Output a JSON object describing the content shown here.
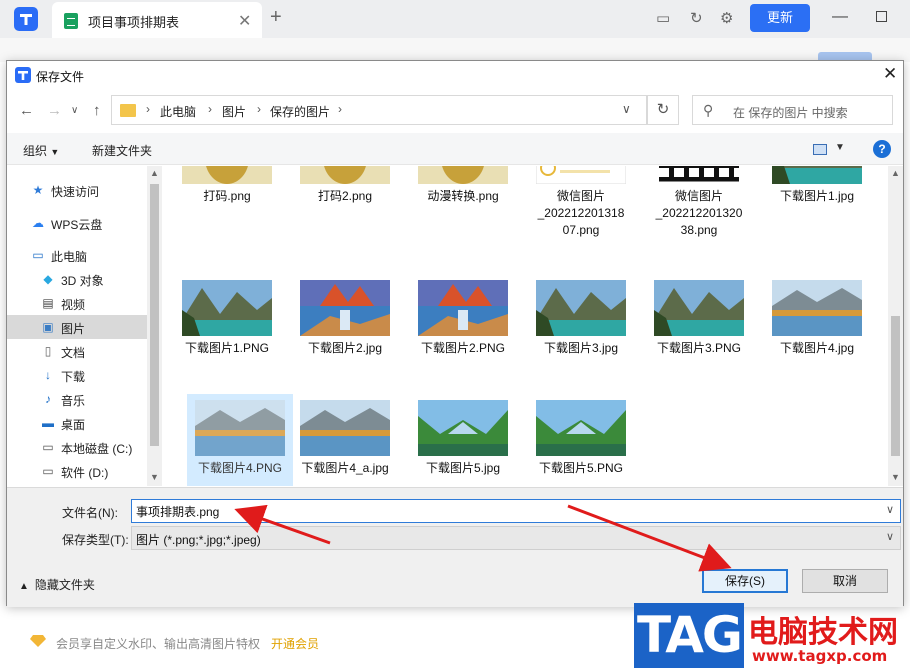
{
  "app": {
    "tab_title": "项目事项排期表",
    "update_label": "更新"
  },
  "dialog": {
    "title": "保存文件",
    "breadcrumb": [
      "此电脑",
      "图片",
      "保存的图片"
    ],
    "search_placeholder": "在 保存的图片 中搜索",
    "toolbar": {
      "organize": "组织",
      "new_folder": "新建文件夹"
    },
    "nav_items": [
      {
        "label": "快速访问",
        "icon": "star-icon",
        "selected": false
      },
      {
        "label": "WPS云盘",
        "icon": "cloud-icon",
        "selected": false
      },
      {
        "label": "此电脑",
        "icon": "computer-icon",
        "selected": false
      },
      {
        "label": "3D 对象",
        "icon": "cube-icon",
        "selected": false
      },
      {
        "label": "视频",
        "icon": "film-icon",
        "selected": false
      },
      {
        "label": "图片",
        "icon": "picture-icon",
        "selected": true
      },
      {
        "label": "文档",
        "icon": "document-icon",
        "selected": false
      },
      {
        "label": "下载",
        "icon": "download-icon",
        "selected": false
      },
      {
        "label": "音乐",
        "icon": "music-icon",
        "selected": false
      },
      {
        "label": "桌面",
        "icon": "desktop-icon",
        "selected": false
      },
      {
        "label": "本地磁盘 (C:)",
        "icon": "drive-icon",
        "selected": false
      },
      {
        "label": "软件 (D:)",
        "icon": "drive-icon",
        "selected": false
      }
    ],
    "files": [
      {
        "name": "打码.png",
        "thumb": "gold"
      },
      {
        "name": "打码2.png",
        "thumb": "gold"
      },
      {
        "name": "动漫转换.png",
        "thumb": "gold"
      },
      {
        "name": "微信图片_20221220131807.png",
        "name_lines": [
          "微信图片",
          "_202212201318",
          "07.png"
        ],
        "thumb": "coupon"
      },
      {
        "name": "微信图片_20221220132038.png",
        "name_lines": [
          "微信图片",
          "_202212201320",
          "38.png"
        ],
        "thumb": "qr"
      },
      {
        "name": "下载图片1.jpg",
        "thumb": "lake"
      },
      {
        "name": "下载图片1.PNG",
        "thumb": "lake"
      },
      {
        "name": "下载图片2.jpg",
        "thumb": "fall"
      },
      {
        "name": "下载图片2.PNG",
        "thumb": "fall"
      },
      {
        "name": "下载图片3.jpg",
        "thumb": "lake"
      },
      {
        "name": "下载图片3.PNG",
        "thumb": "lake"
      },
      {
        "name": "下载图片4.jpg",
        "thumb": "autumn"
      },
      {
        "name": "下载图片4.PNG",
        "thumb": "autumn",
        "selected": true
      },
      {
        "name": "下载图片4_a.jpg",
        "thumb": "autumn"
      },
      {
        "name": "下载图片5.jpg",
        "thumb": "valley"
      },
      {
        "name": "下载图片5.PNG",
        "thumb": "valley"
      }
    ],
    "filename_label": "文件名(N):",
    "filename_value": "事项排期表.png",
    "filetype_label": "保存类型(T):",
    "filetype_value": "图片 (*.png;*.jpg;*.jpeg)",
    "hide_folders": "隐藏文件夹",
    "save_button": "保存(S)",
    "cancel_button": "取消"
  },
  "promo": {
    "text": "会员享自定义水印、输出高清图片特权",
    "link": "开通会员"
  },
  "watermark": {
    "logo": "TAG",
    "site_name": "电脑技术网",
    "url": "www.tagxp.com"
  },
  "colors": {
    "accent": "#2b6ff4",
    "selection": "#cce8ff",
    "annotation_arrow": "#e01b1b",
    "watermark_blue": "#1b63c7"
  }
}
